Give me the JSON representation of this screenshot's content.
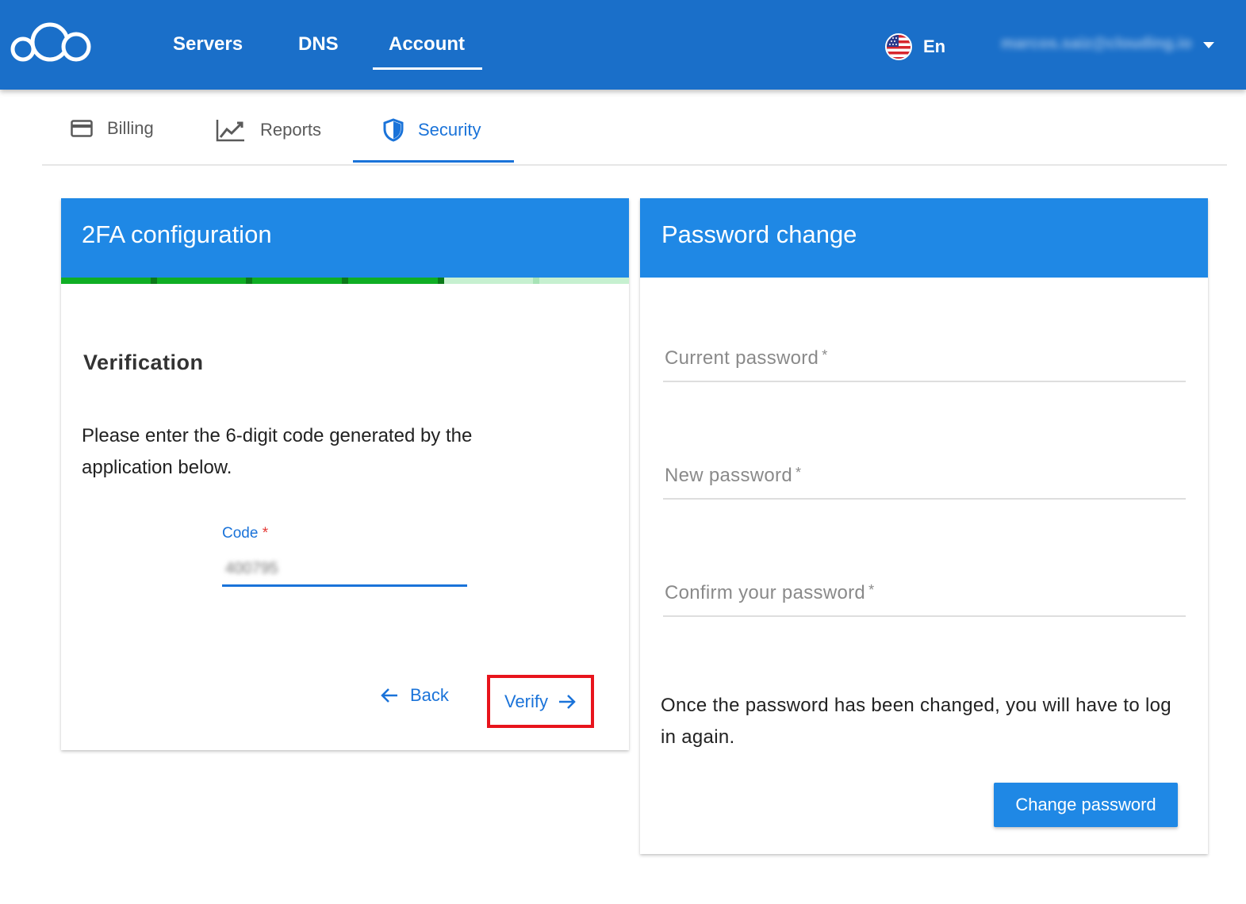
{
  "colors": {
    "topbar": "#1a6fc9",
    "accent": "#1a73d9",
    "card_header": "#1f88e5",
    "step_done": "#0fae24",
    "step_todo": "#c6f0d0",
    "highlight": "#e8141c"
  },
  "topbar": {
    "logo_icon": "cloud-logo-icon",
    "nav": [
      {
        "label": "Servers"
      },
      {
        "label": "DNS"
      },
      {
        "label": "Account"
      }
    ],
    "active_nav": "Account",
    "language": {
      "icon": "us-flag-icon",
      "label": "En"
    },
    "user_email": "marcos.saiz@clouding.io"
  },
  "subtabs": {
    "items": [
      {
        "label": "Billing",
        "icon": "credit-card-icon"
      },
      {
        "label": "Reports",
        "icon": "line-chart-icon"
      },
      {
        "label": "Security",
        "icon": "shield-icon"
      }
    ],
    "active": "Security"
  },
  "twofa": {
    "title": "2FA configuration",
    "stepper": {
      "total_steps": 6,
      "completed_steps": 4
    },
    "step_title": "Verification",
    "instructions": "Please enter the 6-digit code generated by the application below.",
    "code_label": "Code",
    "required_mark": "*",
    "code_value": "400795",
    "back_label": "Back",
    "verify_label": "Verify"
  },
  "password": {
    "title": "Password change",
    "fields": [
      {
        "placeholder": "Current password"
      },
      {
        "placeholder": "New password"
      },
      {
        "placeholder": "Confirm your password"
      }
    ],
    "required_mark": "*",
    "note": "Once the password has been changed, you will have to log in again.",
    "button_label": "Change password"
  }
}
